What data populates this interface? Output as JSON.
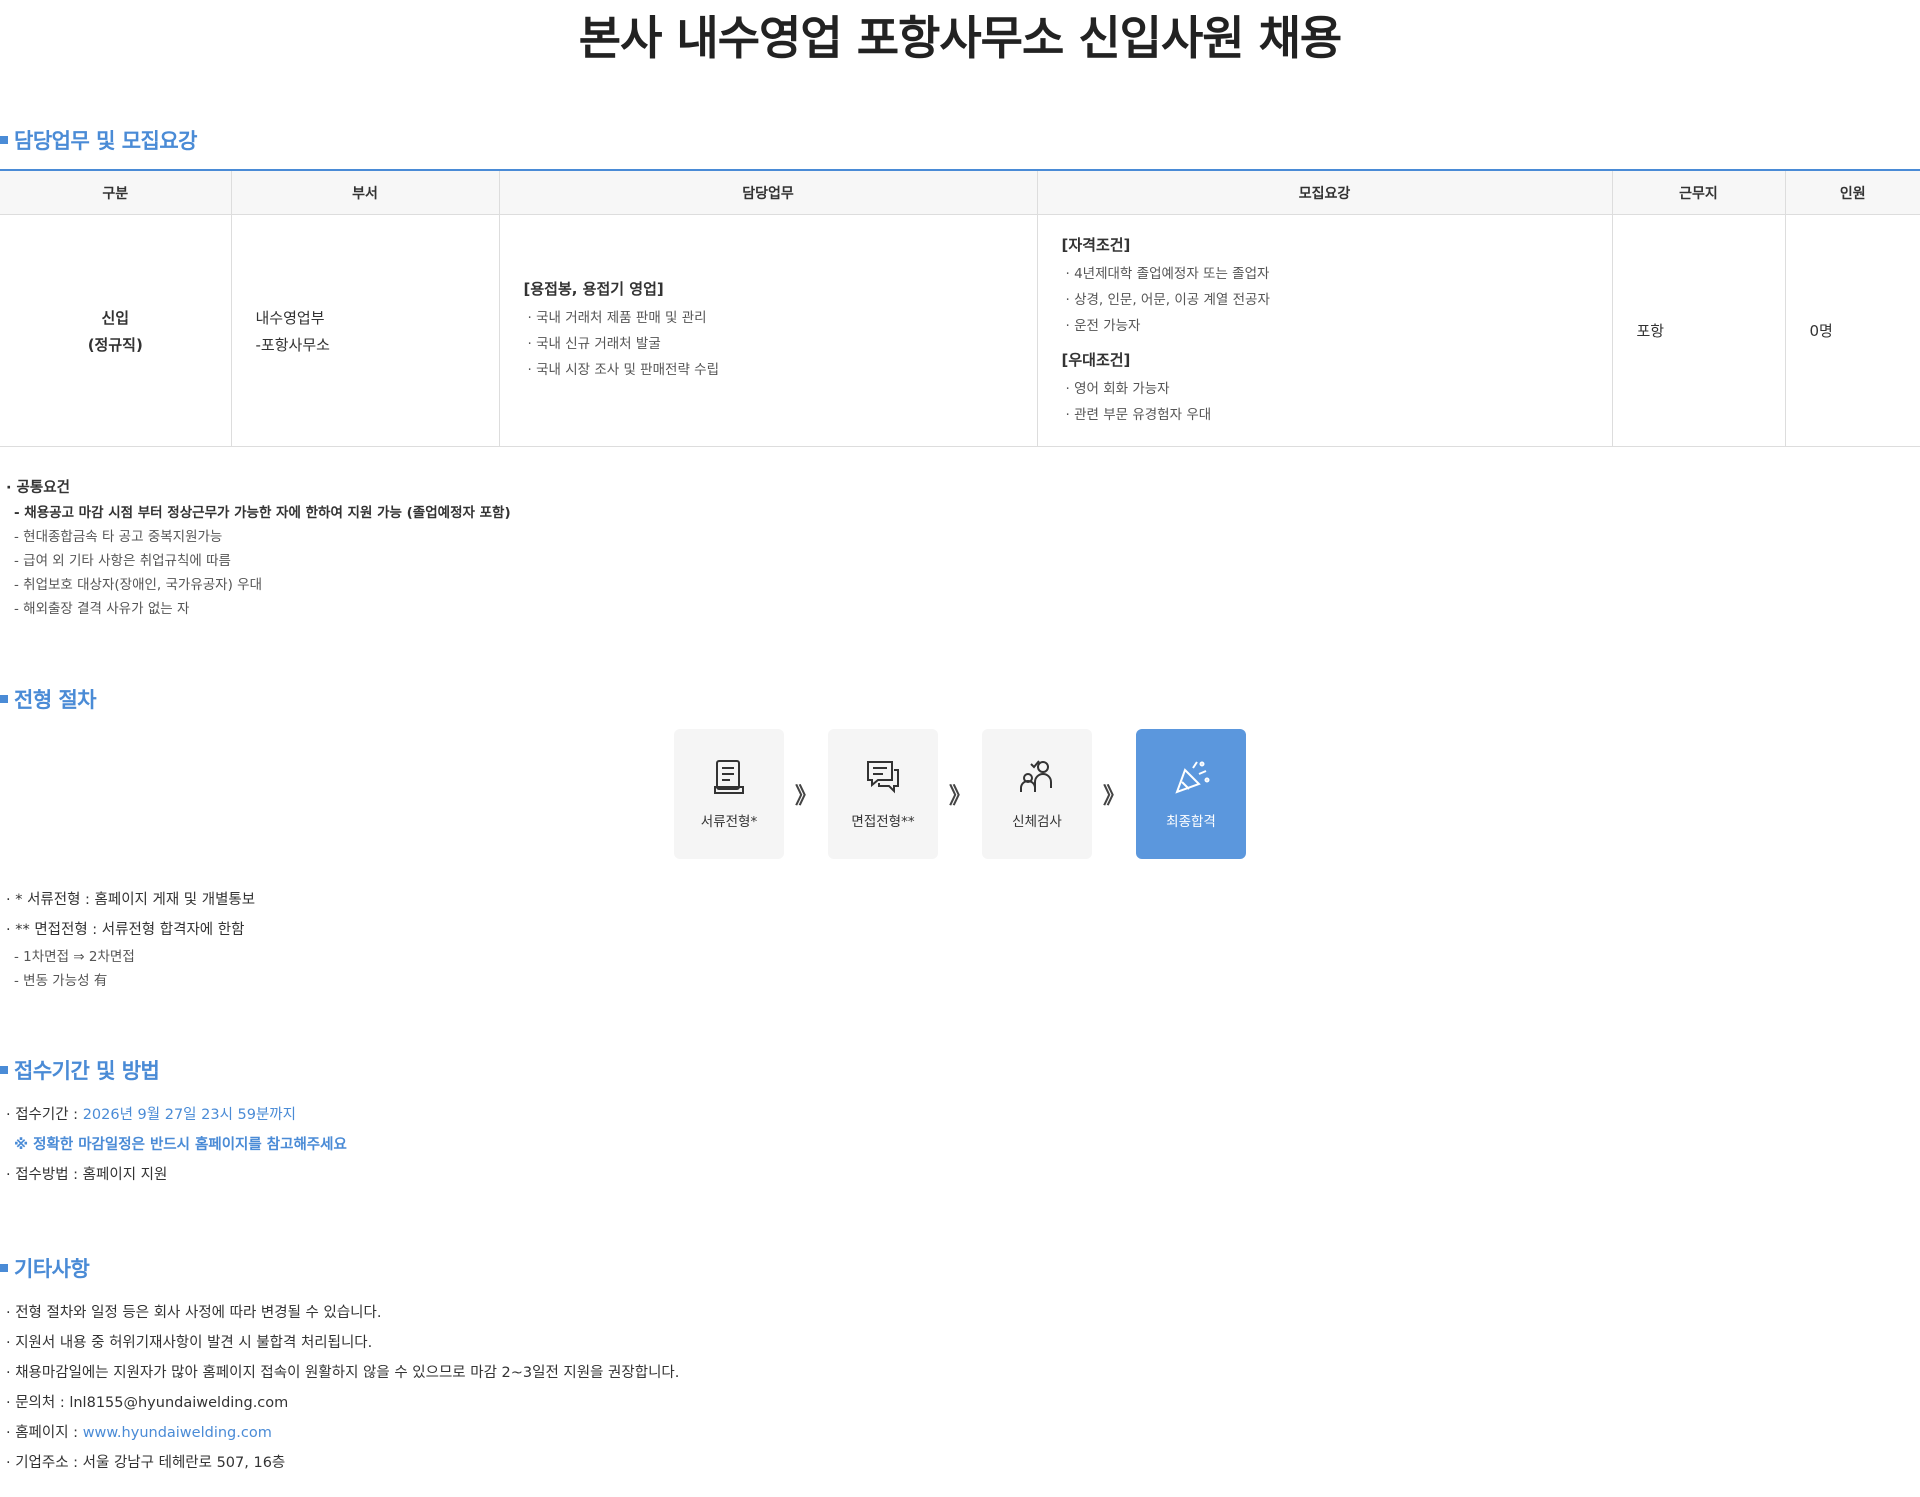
{
  "title": "본사 내수영업 포항사무소 신입사원 채용",
  "sections": {
    "duty": "담당업무 및 모집요강",
    "process": "전형 절차",
    "period": "접수기간 및 방법",
    "others": "기타사항"
  },
  "table": {
    "headers": [
      "구분",
      "부서",
      "담당업무",
      "모집요강",
      "근무지",
      "인원"
    ],
    "row": {
      "type_line1": "신입",
      "type_line2": "(정규직)",
      "dept_line1": "내수영업부",
      "dept_line2": "-포항사무소",
      "duty_head": "[용접봉, 용접기 영업]",
      "duty_items": [
        "· 국내 거래처 제품 판매 및 관리",
        "· 국내 신규 거래처 발굴",
        "· 국내 시장 조사 및 판매전략 수립"
      ],
      "qual_head": "[자격조건]",
      "qual_items": [
        "· 4년제대학 졸업예정자 또는 졸업자",
        "· 상경, 인문, 어문, 이공 계열 전공자",
        "· 운전 가능자"
      ],
      "pref_head": "[우대조건]",
      "pref_items": [
        "· 영어 회화 가능자",
        "· 관련 부문 유경험자 우대"
      ],
      "location": "포항",
      "count": "0명"
    }
  },
  "common": {
    "head": "· 공통요건",
    "lines": [
      "- 채용공고 마감 시점 부터 정상근무가 가능한 자에 한하여 지원 가능 (졸업예정자 포함)",
      "- 현대종합금속 타 공고 중복지원가능",
      "- 급여 외 기타 사항은 취업규칙에 따름",
      "- 취업보호 대상자(장애인, 국가유공자) 우대",
      "- 해외출장 결격 사유가 없는 자"
    ]
  },
  "steps": [
    {
      "label": "서류전형*",
      "icon": "document-icon"
    },
    {
      "label": "면접전형**",
      "icon": "chat-icon"
    },
    {
      "label": "신체검사",
      "icon": "checkup-icon"
    },
    {
      "label": "최종합격",
      "icon": "celebration-icon"
    }
  ],
  "step_arrow": "》",
  "process_notes": {
    "n1": "· * 서류전형 : 홈페이지 게재 및 개별통보",
    "n2": "· ** 면접전형 : 서류전형 합격자에 한함",
    "n3": "- 1차면접 ⇒ 2차면접",
    "n4": "- 변동 가능성 有"
  },
  "period": {
    "label": "· 접수기간 : ",
    "value": "2026년 9월 27일 23시 59분까지",
    "warning": "※ 정확한 마감일정은 반드시 홈페이지를 참고해주세요",
    "method": "· 접수방법 : 홈페이지 지원"
  },
  "others": {
    "l1": "· 전형 절차와 일정 등은 회사 사정에 따라 변경될 수 있습니다.",
    "l2": "· 지원서 내용 중 허위기재사항이 발견 시 불합격 처리됩니다.",
    "l3": "· 채용마감일에는 지원자가 많아 홈페이지 접속이 원활하지 않을 수 있으므로 마감 2~3일전 지원을 권장합니다.",
    "contact": "· 문의처 : lnl8155@hyundaiwelding.com",
    "homepage_label": "· 홈페이지 : ",
    "homepage_url": "www.hyundaiwelding.com",
    "address": "· 기업주소 : 서울 강남구 테헤란로 507, 16층"
  }
}
